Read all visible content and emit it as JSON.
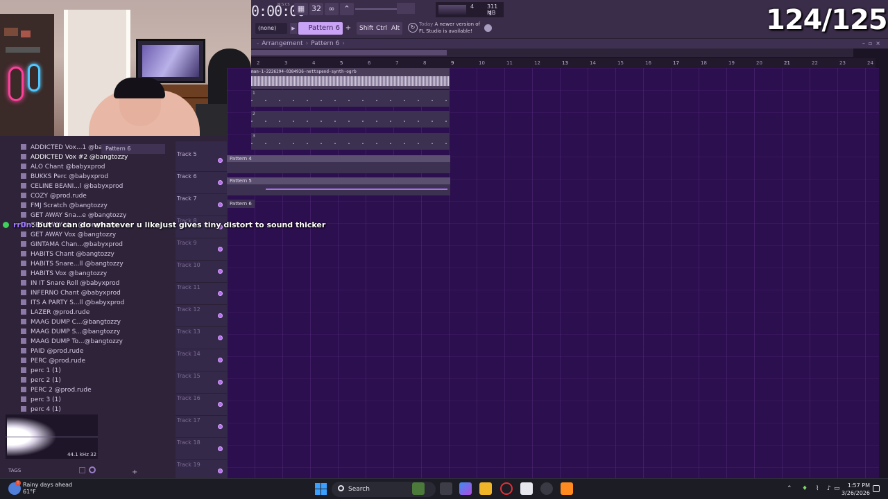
{
  "counter": {
    "text": "124/125"
  },
  "toolbar": {
    "time": "0:00:00",
    "time_unit": "M:S:CS",
    "tempo_mode_label": "32",
    "cpu": "4",
    "memory": "311 MB",
    "polyphony": "1",
    "snap_value": "(none)",
    "pattern_name": "Pattern 6",
    "add_label": "+",
    "shift_label": "Shift",
    "ctrl_label": "Ctrl",
    "alt_label": "Alt",
    "news_day": "Today",
    "news_text_1": "A newer version of",
    "news_text_2": "FL Studio is available!"
  },
  "playlist": {
    "breadcrumb_part1": "Arrangement",
    "breadcrumb_part2": "Pattern 6",
    "ruler": [
      "2",
      "3",
      "4",
      "5",
      "6",
      "7",
      "8",
      "9",
      "10",
      "11",
      "12",
      "13",
      "14",
      "15",
      "16",
      "17",
      "18",
      "19",
      "20",
      "21",
      "22",
      "23",
      "24"
    ],
    "audio_clip_name": "man-1-2226294-0384936-nettspend-synth-ogrb",
    "pattern_rows": [
      "1",
      "2",
      "3"
    ],
    "clips": {
      "track5": "Pattern 4",
      "track6": "Pattern 5",
      "track7": "Pattern 6"
    },
    "tracks": [
      "Track 5",
      "Track 6",
      "Track 7",
      "Track 8",
      "Track 9",
      "Track 10",
      "Track 11",
      "Track 12",
      "Track 13",
      "Track 14",
      "Track 15",
      "Track 16",
      "Track 17",
      "Track 18",
      "Track 19"
    ]
  },
  "browser": {
    "pattern_chip": "Pattern 6",
    "items": [
      "ADDICTED Vox...1 @bangtozzy",
      "ADDICTED Vox #2 @bangtozzy",
      "ALO Chant @babyxprod",
      "BUKKS Perc @babyxprod",
      "CELINE BEANI...l @babyxprod",
      "COZY @prod.rude",
      "FMJ Scratch @bangtozzy",
      "GET AWAY Sna...e @bangtozzy",
      "GET AWAY Vo...@bangtozzy",
      "GET AWAY Vox @bangtozzy",
      "GINTAMA Chan...@babyxprod",
      "HABITS Chant @bangtozzy",
      "HABITS Snare...ll @bangtozzy",
      "HABITS Vox @bangtozzy",
      "IN IT Snare Roll @babyxprod",
      "INFERNO Chant @babyxprod",
      "ITS A PARTY S...ll @babyxprod",
      "LAZER @prod.rude",
      "MAAG DUMP C...@bangtozzy",
      "MAAG DUMP S...@bangtozzy",
      "MAAG DUMP To...@bangtozzy",
      "PAID @prod.rude",
      "PERC @prod.rude",
      "perc 1 (1)",
      "perc 2 (1)",
      "PERC 2 @prod.rude",
      "perc 3 (1)",
      "perc 4 (1)"
    ],
    "preview_info": "44.1 kHz 32",
    "tags_label": "TAGS",
    "add_label": "+"
  },
  "chat": {
    "user": "rr0n",
    "message": ": but u can do whatever u likejust gives tiny distort to sound thicker"
  },
  "taskbar": {
    "weather_line1": "Rainy days ahead",
    "weather_line2": "61°F",
    "search_label": "Search",
    "time": "1:57 PM",
    "date": "3/26/2026"
  },
  "colors": {
    "accent": "#c9a3f5",
    "playlist_bg": "#2c0f4e",
    "track_led": "#b66cf0",
    "chat_user": "#a37cff"
  }
}
